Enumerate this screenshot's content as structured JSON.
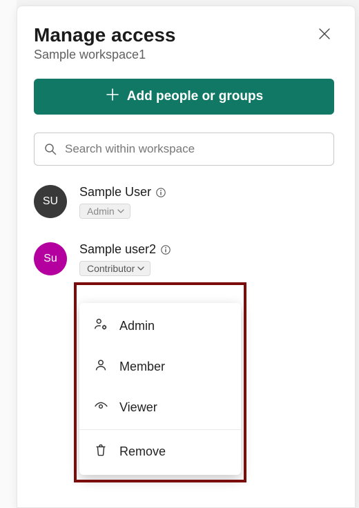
{
  "header": {
    "title": "Manage access",
    "subtitle": "Sample workspace1"
  },
  "actions": {
    "add_button": "Add people or groups"
  },
  "search": {
    "placeholder": "Search within workspace"
  },
  "users": [
    {
      "initials": "SU",
      "name": "Sample User",
      "role_label": "Admin",
      "avatar_color": "dark",
      "editable": false
    },
    {
      "initials": "Su",
      "name": "Sample user2",
      "role_label": "Contributor",
      "avatar_color": "magenta",
      "editable": true
    }
  ],
  "role_dropdown": {
    "options": [
      {
        "label": "Admin",
        "icon": "people-gear-icon"
      },
      {
        "label": "Member",
        "icon": "person-icon"
      },
      {
        "label": "Viewer",
        "icon": "eye-icon"
      }
    ],
    "remove_label": "Remove"
  }
}
